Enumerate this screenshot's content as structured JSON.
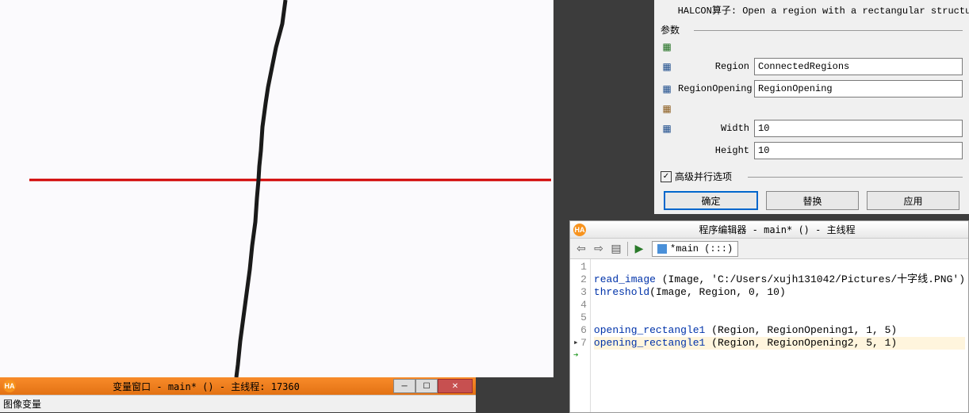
{
  "image_viewer": {},
  "var_window": {
    "title": "变量窗口 - main* () - 主线程: 17360",
    "tab": "图像变量"
  },
  "operator": {
    "desc_label": "HALCON算子:",
    "desc_text": "Open a region with a rectangular structuring eleme",
    "section_params": "参数",
    "params": [
      {
        "icon": "▦",
        "color": "#1a6b1a",
        "label": "",
        "value": ""
      },
      {
        "icon": "▦",
        "color": "#1a4a8a",
        "label": "Region",
        "value": "ConnectedRegions"
      },
      {
        "icon": "▦",
        "color": "#1a4a8a",
        "label": "RegionOpening",
        "value": "RegionOpening"
      },
      {
        "icon": "▦",
        "color": "#8a5a1a",
        "label": "",
        "value": ""
      },
      {
        "icon": "▦",
        "color": "#1a4a8a",
        "label": "Width",
        "value": "10"
      },
      {
        "icon": "▦",
        "color": "",
        "label": "Height",
        "value": "10"
      }
    ],
    "adv_label": "高级并行选项",
    "adv_checked": true,
    "buttons": {
      "ok": "确定",
      "replace": "替换",
      "apply": "应用"
    }
  },
  "editor": {
    "title": "程序编辑器 - main* () - 主线程",
    "tab_label": "*main (:::)",
    "current_marker_line": 7,
    "highlighted_line": 7,
    "lines": [
      {
        "n": 1,
        "text": ""
      },
      {
        "n": 2,
        "fn": "read_image",
        "rest": " (Image, 'C:/Users/xujh131042/Pictures/十字线.PNG')"
      },
      {
        "n": 3,
        "fn": "threshold",
        "rest": "(Image, Region, 0, 10)"
      },
      {
        "n": 4,
        "text": ""
      },
      {
        "n": 5,
        "text": ""
      },
      {
        "n": 6,
        "fn": "opening_rectangle1",
        "rest": " (Region, RegionOpening1, 1, 5)"
      },
      {
        "n": 7,
        "fn": "opening_rectangle1",
        "rest": " (Region, RegionOpening2, 5, 1)"
      }
    ]
  }
}
